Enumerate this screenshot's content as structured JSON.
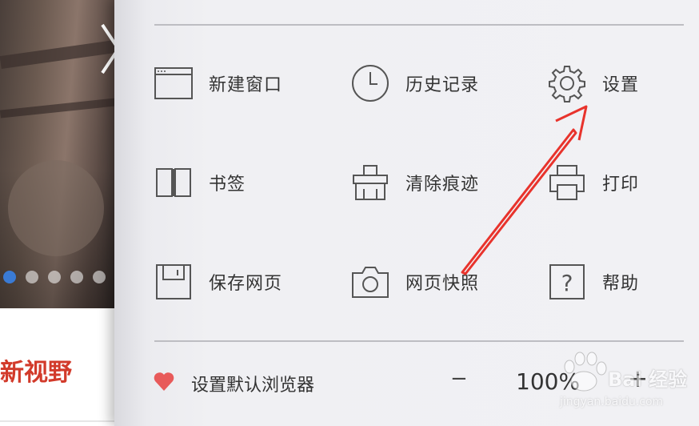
{
  "background_page": {
    "headline": "新视野",
    "carousel": {
      "dot_count": 5,
      "active_index": 0
    }
  },
  "menu": {
    "items": [
      {
        "label": "新建窗口",
        "icon": "new-window-icon"
      },
      {
        "label": "历史记录",
        "icon": "clock-icon"
      },
      {
        "label": "设置",
        "icon": "gear-icon"
      },
      {
        "label": "书签",
        "icon": "book-icon"
      },
      {
        "label": "清除痕迹",
        "icon": "broom-icon"
      },
      {
        "label": "打印",
        "icon": "printer-icon"
      },
      {
        "label": "保存网页",
        "icon": "save-icon"
      },
      {
        "label": "网页快照",
        "icon": "camera-icon"
      },
      {
        "label": "帮助",
        "icon": "help-icon"
      }
    ],
    "footer": {
      "default_browser_label": "设置默认浏览器",
      "zoom_minus": "−",
      "zoom_value": "100%",
      "zoom_plus": "+"
    }
  },
  "watermark": {
    "brand": "Bai 经验",
    "url": "jingyan.baidu.com"
  },
  "colors": {
    "accent_red": "#e8332c",
    "heart": "#e85a5a",
    "active_dot": "#3a7bd5",
    "headline_red": "#d23a2a"
  }
}
